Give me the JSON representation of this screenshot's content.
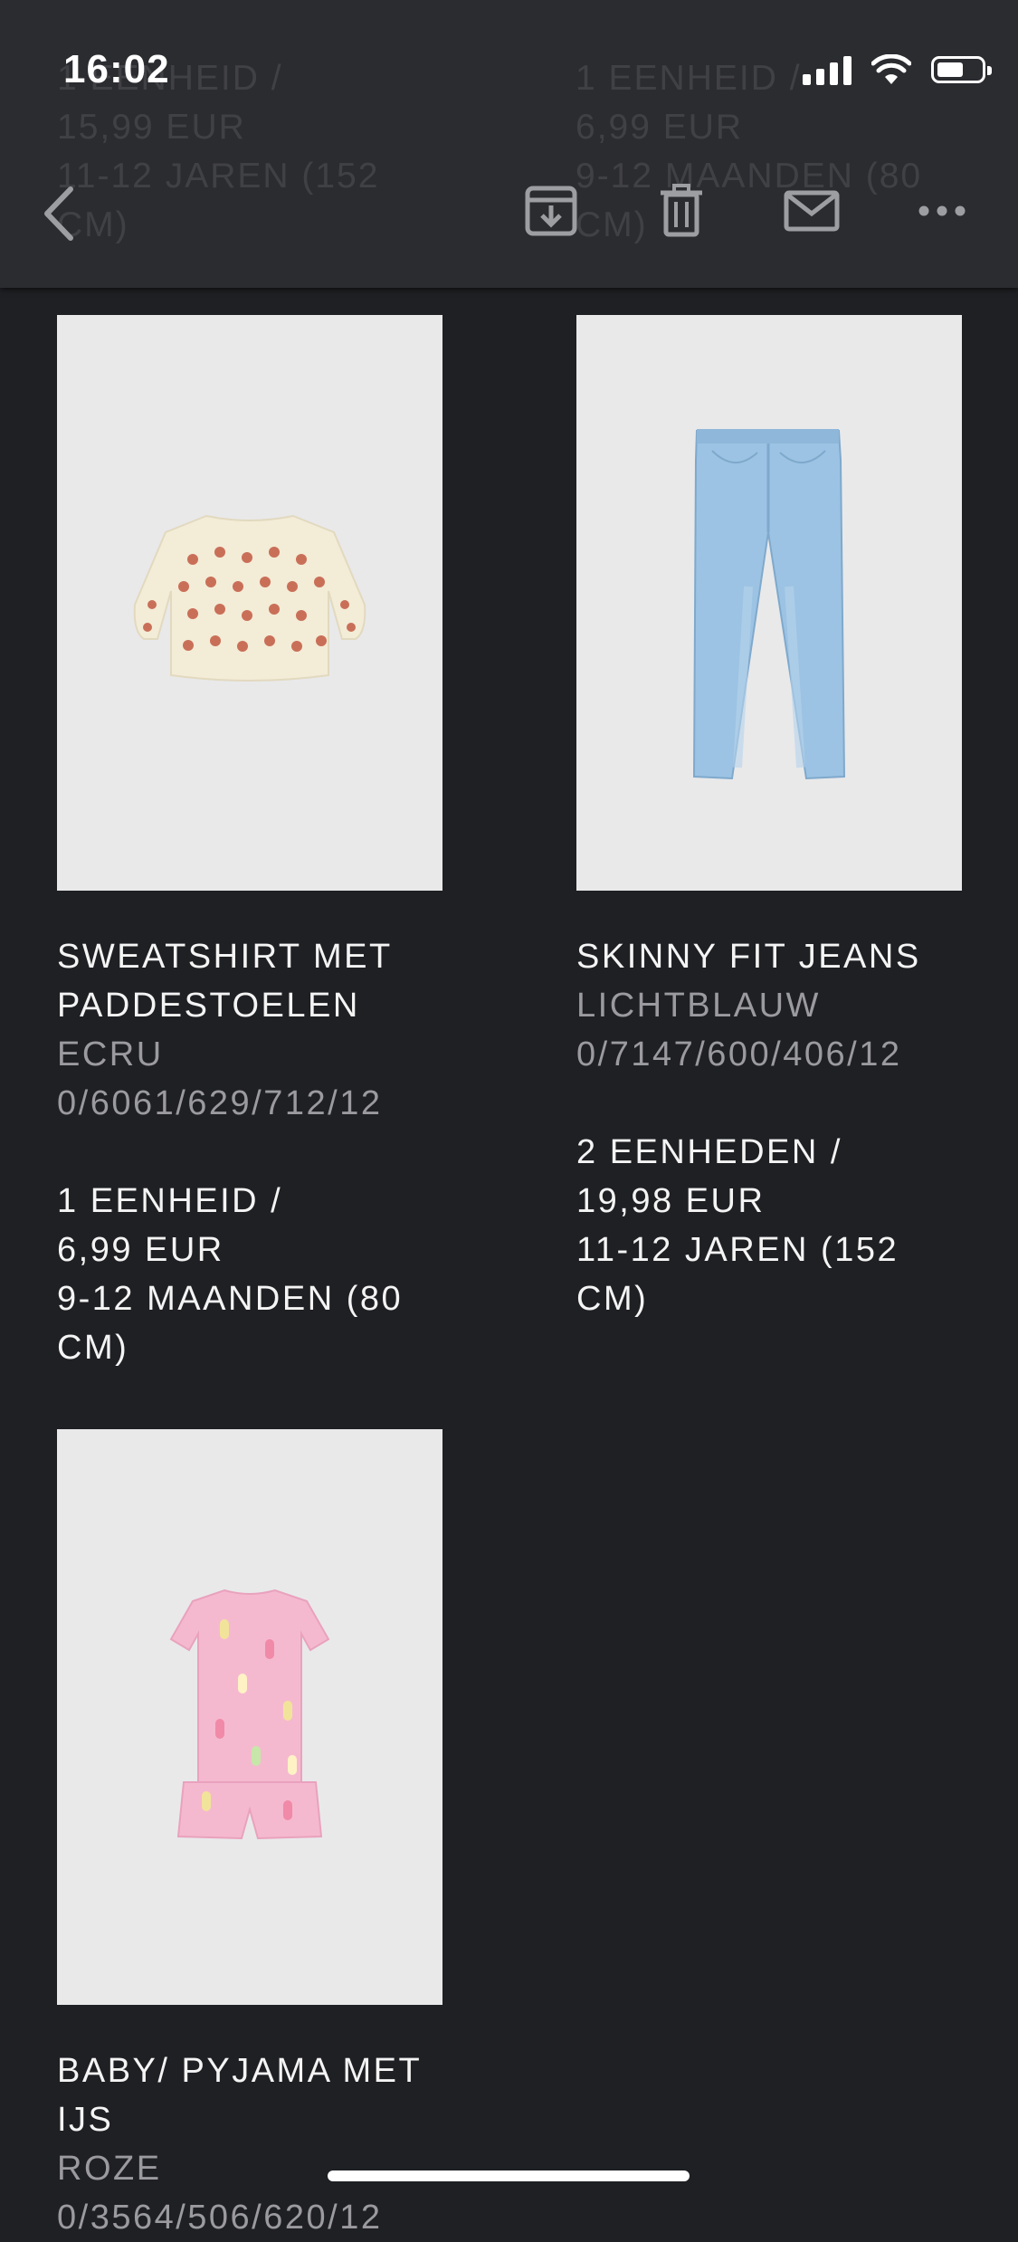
{
  "status_bar": {
    "time": "16:02"
  },
  "toolbar": {
    "icons": [
      "chevron-left-icon",
      "archive-icon",
      "trash-icon",
      "mail-icon",
      "more-icon"
    ]
  },
  "ghost_text": {
    "left": "1 EENHEID /\n15,99 EUR\n11-12 JAREN (152\nCM)",
    "right": "1 EENHEID /\n6,99 EUR\n9-12 MAANDEN (80\nCM)"
  },
  "products": [
    {
      "name_line1": "SWEATSHIRT MET",
      "name_line2": "PADDESTOELEN",
      "color": "ECRU",
      "ref": "0/6061/629/712/12",
      "qty": "1 EENHEID /",
      "price": "6,99 EUR",
      "size_line1": "9-12 MAANDEN (80",
      "size_line2": "CM)",
      "image_icon": "sweatshirt-image"
    },
    {
      "name_line1": "SKINNY FIT JEANS",
      "color": "LICHTBLAUW",
      "ref": "0/7147/600/406/12",
      "qty": "2 EENHEDEN /",
      "price": "19,98 EUR",
      "size_line1": "11-12 JAREN (152",
      "size_line2": "CM)",
      "image_icon": "jeans-image"
    },
    {
      "name_line1": "BABY/ PYJAMA MET",
      "name_line2": "IJS",
      "color": "ROZE",
      "ref": "0/3564/506/620/12",
      "image_icon": "pyjama-image"
    }
  ],
  "colors": {
    "background": "#1f2024",
    "toolbar": "#2c2d31",
    "image_bg": "#e9e9ea",
    "secondary_text": "#9b9b9f"
  }
}
